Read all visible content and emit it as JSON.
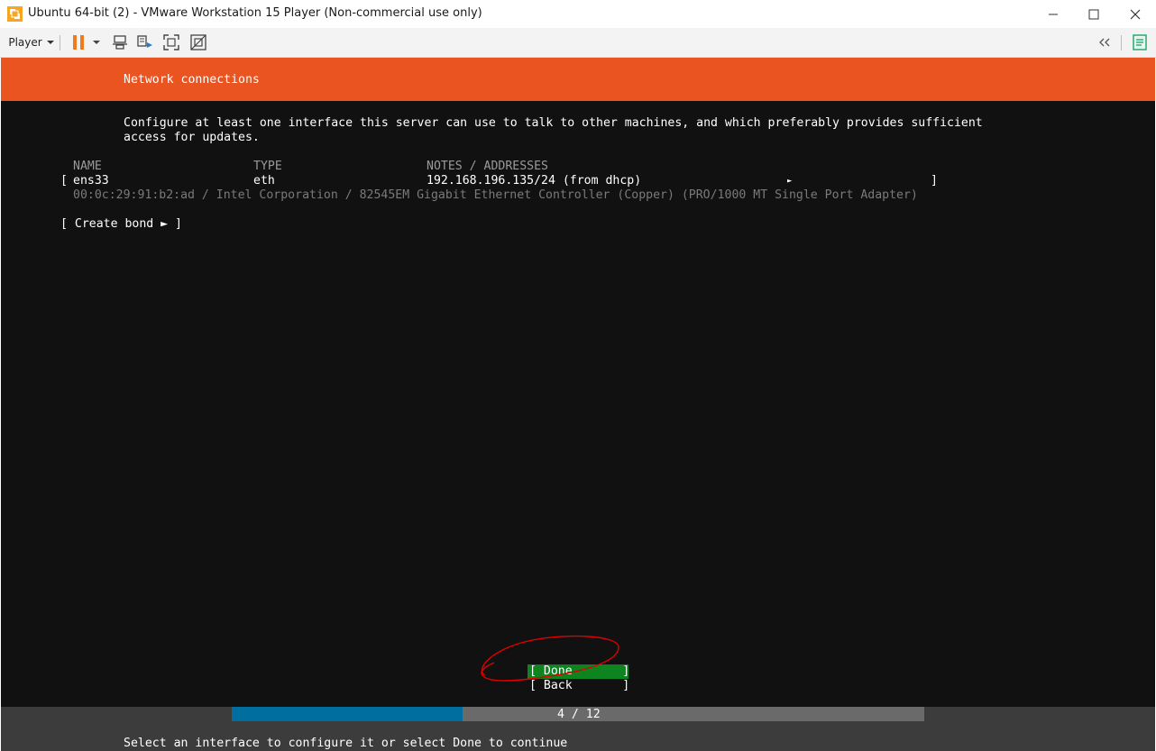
{
  "window": {
    "title": "Ubuntu 64-bit (2) - VMware Workstation 15 Player (Non-commercial use only)"
  },
  "toolbar": {
    "player_label": "Player"
  },
  "colors": {
    "header": "#e95420",
    "done_button": "#0e8420",
    "progress_fill": "#006fa0",
    "annotation": "#e00000"
  },
  "screen": {
    "header_title": "Network connections",
    "description_line1": "Configure at least one interface this server can use to talk to other machines, and which preferably provides sufficient",
    "description_line2": "access for updates.",
    "table": {
      "headers": {
        "name": "NAME",
        "type": "TYPE",
        "notes": "NOTES / ADDRESSES"
      },
      "row": {
        "open_bracket": "[",
        "name": "ens33",
        "type": "eth",
        "address": "192.168.196.135/24 (from dhcp)",
        "arrow": "►",
        "close_bracket": "]",
        "detail": "00:0c:29:91:b2:ad / Intel Corporation / 82545EM Gigabit Ethernet Controller (Copper) (PRO/1000 MT Single Port Adapter)"
      }
    },
    "create_bond": "[ Create bond ► ]",
    "buttons": {
      "done": "[ Done       ]",
      "back": "[ Back       ]"
    },
    "progress": {
      "text": "4 / 12",
      "current": 4,
      "total": 12
    },
    "footer_hint": "Select an interface to configure it or select Done to continue"
  }
}
